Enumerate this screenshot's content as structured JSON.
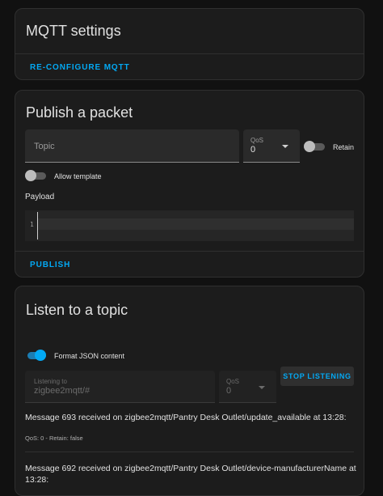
{
  "mqtt_settings": {
    "title": "MQTT settings",
    "reconfigure_label": "RE-CONFIGURE MQTT"
  },
  "publish": {
    "title": "Publish a packet",
    "topic_placeholder": "Topic",
    "qos_label": "QoS",
    "qos_value": "0",
    "retain_label": "Retain",
    "retain_on": false,
    "allow_template_label": "Allow template",
    "allow_template_on": false,
    "payload_label": "Payload",
    "payload_line_number": "1",
    "publish_label": "PUBLISH"
  },
  "listen": {
    "title": "Listen to a topic",
    "format_json_label": "Format JSON content",
    "format_json_on": true,
    "listening_label": "Listening to",
    "listening_value": "zigbee2mqtt/#",
    "qos_label": "QoS",
    "qos_value": "0",
    "stop_label": "STOP LISTENING",
    "messages": [
      {
        "title": "Message 693 received on zigbee2mqtt/Pantry Desk Outlet/update_available at 13:28:",
        "meta": "QoS: 0 - Retain: false"
      },
      {
        "title": "Message 692 received on zigbee2mqtt/Pantry Desk Outlet/device-manufacturerName at 13:28:"
      }
    ]
  },
  "colors": {
    "accent": "#03a9f4",
    "card_background": "#1c1c1c",
    "page_background": "#111111"
  }
}
